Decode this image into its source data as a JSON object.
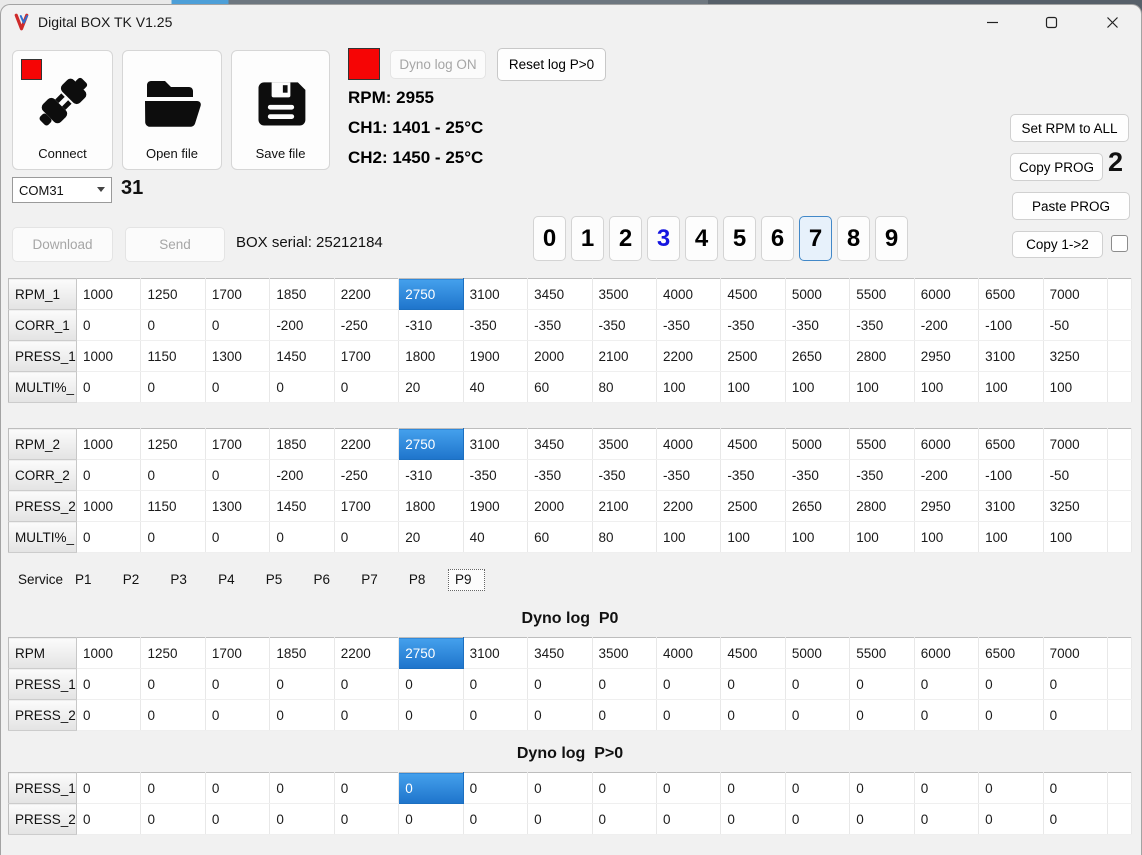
{
  "window": {
    "title": "Digital BOX TK V1.25",
    "controls": {
      "minimize": "–",
      "maximize": "□",
      "close": "✕"
    }
  },
  "colors": {
    "indicator_red": "#f60505",
    "selection_blue_top": "#44a0ec",
    "selection_blue_bottom": "#1e74cb",
    "digit_blue_text": "#1515e0",
    "selected_digit_border": "#4288c8"
  },
  "toolbar": {
    "connect_label": "Connect",
    "open_file_label": "Open file",
    "save_file_label": "Save file",
    "dyno_log_label": "Dyno log ON",
    "reset_log_label": "Reset log P>0",
    "download_label": "Download",
    "send_label": "Send",
    "box_serial": "BOX serial: 25212184",
    "com_port_value": "COM31",
    "com_number": "31",
    "set_rpm_all_label": "Set RPM to ALL",
    "copy_prog_label": "Copy PROG",
    "copy_prog_count": "2",
    "paste_prog_label": "Paste PROG",
    "copy_1_2_label": "Copy 1->2",
    "copy_1_2_checked": false
  },
  "telemetry": {
    "rpm": "RPM: 2955",
    "ch1": "CH1: 1401 - 25°C",
    "ch2": "CH2: 1450 - 25°C"
  },
  "digits": {
    "labels": [
      "0",
      "1",
      "2",
      "3",
      "4",
      "5",
      "6",
      "7",
      "8",
      "9"
    ],
    "blue_index": 3,
    "selected_index": 7
  },
  "tabs": {
    "items": [
      "Service",
      "P1",
      "P2",
      "P3",
      "P4",
      "P5",
      "P6",
      "P7",
      "P8",
      "P9"
    ],
    "selected": "P9"
  },
  "headings": {
    "dyno_p0": "Dyno log  P0",
    "dyno_pgt0": "Dyno log  P>0"
  },
  "tables": [
    {
      "name": "prog1",
      "rows": [
        {
          "label": "RPM_1",
          "selected": 5,
          "values": [
            1000,
            1250,
            1700,
            1850,
            2200,
            2750,
            3100,
            3450,
            3500,
            4000,
            4500,
            5000,
            5500,
            6000,
            6500,
            7000
          ]
        },
        {
          "label": "CORR_1",
          "values": [
            0,
            0,
            0,
            -200,
            -250,
            -310,
            -350,
            -350,
            -350,
            -350,
            -350,
            -350,
            -350,
            -200,
            -100,
            -50
          ]
        },
        {
          "label": "PRESS_1",
          "values": [
            1000,
            1150,
            1300,
            1450,
            1700,
            1800,
            1900,
            2000,
            2100,
            2200,
            2500,
            2650,
            2800,
            2950,
            3100,
            3250
          ]
        },
        {
          "label": "MULTI%_",
          "values": [
            0,
            0,
            0,
            0,
            0,
            20,
            40,
            60,
            80,
            100,
            100,
            100,
            100,
            100,
            100,
            100
          ]
        }
      ]
    },
    {
      "name": "prog2",
      "rows": [
        {
          "label": "RPM_2",
          "selected": 5,
          "values": [
            1000,
            1250,
            1700,
            1850,
            2200,
            2750,
            3100,
            3450,
            3500,
            4000,
            4500,
            5000,
            5500,
            6000,
            6500,
            7000
          ]
        },
        {
          "label": "CORR_2",
          "values": [
            0,
            0,
            0,
            -200,
            -250,
            -310,
            -350,
            -350,
            -350,
            -350,
            -350,
            -350,
            -350,
            -200,
            -100,
            -50
          ]
        },
        {
          "label": "PRESS_2",
          "values": [
            1000,
            1150,
            1300,
            1450,
            1700,
            1800,
            1900,
            2000,
            2100,
            2200,
            2500,
            2650,
            2800,
            2950,
            3100,
            3250
          ]
        },
        {
          "label": "MULTI%_",
          "values": [
            0,
            0,
            0,
            0,
            0,
            20,
            40,
            60,
            80,
            100,
            100,
            100,
            100,
            100,
            100,
            100
          ]
        }
      ]
    },
    {
      "name": "dyno_p0",
      "rows": [
        {
          "label": "RPM",
          "selected": 5,
          "values": [
            1000,
            1250,
            1700,
            1850,
            2200,
            2750,
            3100,
            3450,
            3500,
            4000,
            4500,
            5000,
            5500,
            6000,
            6500,
            7000
          ]
        },
        {
          "label": "PRESS_1",
          "values": [
            0,
            0,
            0,
            0,
            0,
            0,
            0,
            0,
            0,
            0,
            0,
            0,
            0,
            0,
            0,
            0
          ]
        },
        {
          "label": "PRESS_2",
          "values": [
            0,
            0,
            0,
            0,
            0,
            0,
            0,
            0,
            0,
            0,
            0,
            0,
            0,
            0,
            0,
            0
          ]
        }
      ]
    },
    {
      "name": "dyno_pgt0",
      "rows": [
        {
          "label": "PRESS_1",
          "selected": 5,
          "values": [
            0,
            0,
            0,
            0,
            0,
            0,
            0,
            0,
            0,
            0,
            0,
            0,
            0,
            0,
            0,
            0
          ]
        },
        {
          "label": "PRESS_2",
          "values": [
            0,
            0,
            0,
            0,
            0,
            0,
            0,
            0,
            0,
            0,
            0,
            0,
            0,
            0,
            0,
            0
          ]
        }
      ]
    }
  ]
}
